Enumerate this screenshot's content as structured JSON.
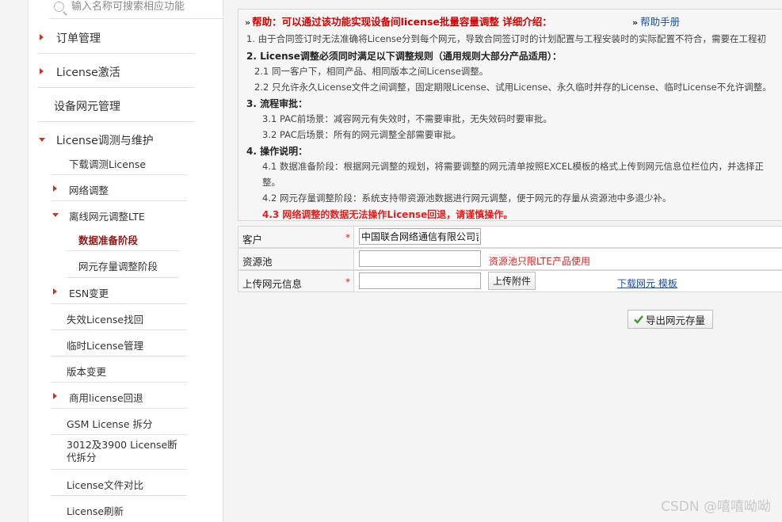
{
  "search": {
    "placeholder": "输入名称可搜索相应功能"
  },
  "sidebar": {
    "order_mgmt": "订单管理",
    "license_activate": "License激活",
    "ne_mgmt": "设备网元管理",
    "license_adjust": "License调测与维护",
    "download_license": "下载调测License",
    "network_adjust": "网络调整",
    "offline_lte": "离线网元调整LTE",
    "data_prep": "数据准备阶段",
    "ne_stock": "网元存量调整阶段",
    "esn_change": "ESN变更",
    "invalid_recover": "失效License找回",
    "temp_license": "临时License管理",
    "version_change": "版本变更",
    "commercial_rollback": "商用license回退",
    "gsm_split": "GSM License 拆分",
    "split_3012": "3012及3900 License断代拆分",
    "file_compare": "License文件对比",
    "refresh": "License刷新"
  },
  "help": {
    "toggle_icon": "double-chevron-down-icon",
    "title": "帮助：可以通过该功能实现设备间license批量容量调整 详细介绍：",
    "manual_icon": "double-chevron-right-icon",
    "manual_link": "帮助手册",
    "line1": "1. 由于合同签订时无法准确将License分到每个网元，导致合同签订时的计划配置与工程安装时的实际配置不符合，需要在工程初",
    "line2": "2. License调整必须同时满足以下调整规则（通用规则大部分产品适用）：",
    "line2_1": "2.1 同一客户下，相同产品、相同版本之间License调整。",
    "line2_2": "2.2 只允许永久License文件之间调整，固定期限License、试用License、永久临时并存的License、临时License不允许调整。",
    "line3": "3. 流程审批：",
    "line3_1": "3.1 PAC前场景：减容网元有失效时，不需要审批，无失效码时要审批。",
    "line3_2": "3.2 PAC后场景：所有的网元调整全部需要审批。",
    "line4": "4. 操作说明：",
    "line4_1a": "4.1 数据准备阶段：根据网元调整的规划，将需要调整的网元清单按照EXCEL模板的格式上传到网元信息位栏位内，并选择正",
    "line4_1b": "整。",
    "line4_2": "4.2 网元存量调整阶段：系统支持带资源池数据进行网元调整，便于网元的存量从资源池中多退少补。",
    "line4_3": "4.3 网络调整的数据无法操作License回退，请谨慎操作。"
  },
  "form": {
    "customer_label": "客户",
    "customer_required": "*",
    "customer_value": "中国联合网络通信有限公司吉",
    "pool_label": "资源池",
    "pool_value": "",
    "pool_hint": "资源池只限LTE产品使用",
    "upload_label": "上传网元信息",
    "upload_required": "*",
    "upload_value": "",
    "upload_button": "上传附件",
    "download_template": "下载网元 模板"
  },
  "export_button": "导出网元存量",
  "watermark": "CSDN @嘻嘻呦呦",
  "colors": {
    "accent_red": "#e02020",
    "link_blue": "#1a4fa0",
    "active_dark_red": "#8b1a1a"
  }
}
